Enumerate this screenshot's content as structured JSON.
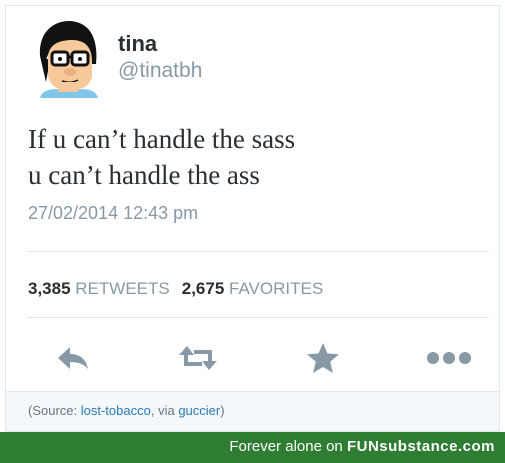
{
  "tweet": {
    "display_name": "tina",
    "handle": "@tinatbh",
    "text_line1": "If u can’t handle the sass",
    "text_line2": "u can’t handle the ass",
    "timestamp": "27/02/2014 12:43 pm",
    "retweets_count": "3,385",
    "retweets_label": "RETWEETS",
    "favorites_count": "2,675",
    "favorites_label": "FAVORITES",
    "avatar_icon": "cartoon-avatar-icon"
  },
  "actions": [
    {
      "name": "reply-icon"
    },
    {
      "name": "retweet-icon"
    },
    {
      "name": "favorite-icon"
    },
    {
      "name": "more-icon"
    }
  ],
  "source": {
    "prefix": "(Source: ",
    "link1": "lost-tobacco",
    "middle": ", via ",
    "link2": "guccier",
    "suffix": ")"
  },
  "footer": {
    "text": "Forever alone on ",
    "brand": "FUNsubstance.com"
  },
  "colors": {
    "text": "#292f33",
    "muted": "#8899a6",
    "link": "#2b7bb9",
    "footer_bg": "#2e7d32"
  }
}
